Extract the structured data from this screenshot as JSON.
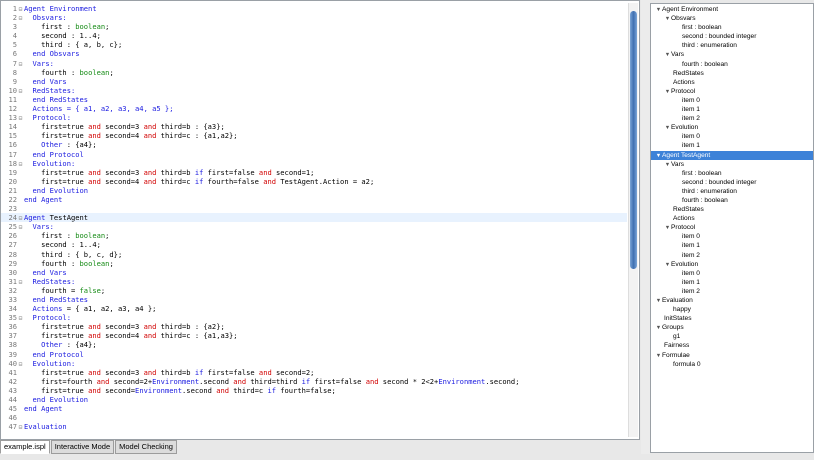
{
  "editor": {
    "current_line": 24,
    "lines": [
      {
        "n": "1",
        "fold": "⊟",
        "tokens": [
          {
            "t": "Agent Environment",
            "c": "section"
          }
        ]
      },
      {
        "n": "2",
        "fold": "⊟",
        "tokens": [
          {
            "t": "  Obsvars:",
            "c": "section"
          }
        ]
      },
      {
        "n": "3",
        "tokens": [
          {
            "t": "    first : "
          },
          {
            "t": "boolean",
            "c": "val"
          },
          {
            "t": ";"
          }
        ]
      },
      {
        "n": "4",
        "tokens": [
          {
            "t": "    second : 1..4;"
          }
        ]
      },
      {
        "n": "5",
        "tokens": [
          {
            "t": "    third : { a, b, c};"
          }
        ]
      },
      {
        "n": "6",
        "tokens": [
          {
            "t": "  end Obsvars",
            "c": "section"
          }
        ]
      },
      {
        "n": "7",
        "fold": "⊟",
        "tokens": [
          {
            "t": "  Vars:",
            "c": "section"
          }
        ]
      },
      {
        "n": "8",
        "tokens": [
          {
            "t": "    fourth : "
          },
          {
            "t": "boolean",
            "c": "val"
          },
          {
            "t": ";"
          }
        ]
      },
      {
        "n": "9",
        "tokens": [
          {
            "t": "  end Vars",
            "c": "section"
          }
        ]
      },
      {
        "n": "10",
        "fold": "⊟",
        "tokens": [
          {
            "t": "  RedStates:",
            "c": "section"
          }
        ]
      },
      {
        "n": "11",
        "tokens": [
          {
            "t": "  end RedStates",
            "c": "section"
          }
        ]
      },
      {
        "n": "12",
        "tokens": [
          {
            "t": "  Actions = { a1, a2, a3, a4, a5 };",
            "c": "section"
          }
        ]
      },
      {
        "n": "13",
        "fold": "⊟",
        "tokens": [
          {
            "t": "  Protocol:",
            "c": "section"
          }
        ]
      },
      {
        "n": "14",
        "tokens": [
          {
            "t": "    first=true "
          },
          {
            "t": "and",
            "c": "op"
          },
          {
            "t": " second=3 "
          },
          {
            "t": "and",
            "c": "op"
          },
          {
            "t": " third=b : {a3};"
          }
        ]
      },
      {
        "n": "15",
        "tokens": [
          {
            "t": "    first=true "
          },
          {
            "t": "and",
            "c": "op"
          },
          {
            "t": " second=4 "
          },
          {
            "t": "and",
            "c": "op"
          },
          {
            "t": " third=c : {a1,a2};"
          }
        ]
      },
      {
        "n": "16",
        "tokens": [
          {
            "t": "    Other",
            "c": "section"
          },
          {
            "t": " : {a4};"
          }
        ]
      },
      {
        "n": "17",
        "tokens": [
          {
            "t": "  end Protocol",
            "c": "section"
          }
        ]
      },
      {
        "n": "18",
        "fold": "⊟",
        "tokens": [
          {
            "t": "  Evolution:",
            "c": "section"
          }
        ]
      },
      {
        "n": "19",
        "tokens": [
          {
            "t": "    first=true "
          },
          {
            "t": "and",
            "c": "op"
          },
          {
            "t": " second=3 "
          },
          {
            "t": "and",
            "c": "op"
          },
          {
            "t": " third=b "
          },
          {
            "t": "if",
            "c": "section"
          },
          {
            "t": " first=false "
          },
          {
            "t": "and",
            "c": "op"
          },
          {
            "t": " second=1;"
          }
        ]
      },
      {
        "n": "20",
        "tokens": [
          {
            "t": "    first=true "
          },
          {
            "t": "and",
            "c": "op"
          },
          {
            "t": " second=4 "
          },
          {
            "t": "and",
            "c": "op"
          },
          {
            "t": " third=c "
          },
          {
            "t": "if",
            "c": "section"
          },
          {
            "t": " fourth=false "
          },
          {
            "t": "and",
            "c": "op"
          },
          {
            "t": " TestAgent.Action = a2;"
          }
        ]
      },
      {
        "n": "21",
        "tokens": [
          {
            "t": "  end Evolution",
            "c": "section"
          }
        ]
      },
      {
        "n": "22",
        "tokens": [
          {
            "t": "end Agent",
            "c": "section"
          }
        ]
      },
      {
        "n": "23",
        "tokens": []
      },
      {
        "n": "24",
        "fold": "⊟",
        "tokens": [
          {
            "t": "Agent",
            "c": "section"
          },
          {
            "t": " TestAgent"
          }
        ]
      },
      {
        "n": "25",
        "fold": "⊟",
        "tokens": [
          {
            "t": "  Vars:",
            "c": "section"
          }
        ]
      },
      {
        "n": "26",
        "tokens": [
          {
            "t": "    first : "
          },
          {
            "t": "boolean",
            "c": "val"
          },
          {
            "t": ";"
          }
        ]
      },
      {
        "n": "27",
        "tokens": [
          {
            "t": "    second : 1..4;"
          }
        ]
      },
      {
        "n": "28",
        "tokens": [
          {
            "t": "    third : { b, c, d};"
          }
        ]
      },
      {
        "n": "29",
        "tokens": [
          {
            "t": "    fourth : "
          },
          {
            "t": "boolean",
            "c": "val"
          },
          {
            "t": ";"
          }
        ]
      },
      {
        "n": "30",
        "tokens": [
          {
            "t": "  end Vars",
            "c": "section"
          }
        ]
      },
      {
        "n": "31",
        "fold": "⊟",
        "tokens": [
          {
            "t": "  RedStates:",
            "c": "section"
          }
        ]
      },
      {
        "n": "32",
        "tokens": [
          {
            "t": "    fourth = "
          },
          {
            "t": "false",
            "c": "val"
          },
          {
            "t": ";"
          }
        ]
      },
      {
        "n": "33",
        "tokens": [
          {
            "t": "  end RedStates",
            "c": "section"
          }
        ]
      },
      {
        "n": "34",
        "tokens": [
          {
            "t": "  Actions",
            "c": "section"
          },
          {
            "t": " = { a1, a2, a3, a4 };"
          }
        ]
      },
      {
        "n": "35",
        "fold": "⊟",
        "tokens": [
          {
            "t": "  Protocol:",
            "c": "section"
          }
        ]
      },
      {
        "n": "36",
        "tokens": [
          {
            "t": "    first=true "
          },
          {
            "t": "and",
            "c": "op"
          },
          {
            "t": " second=3 "
          },
          {
            "t": "and",
            "c": "op"
          },
          {
            "t": " third=b : {a2};"
          }
        ]
      },
      {
        "n": "37",
        "tokens": [
          {
            "t": "    first=true "
          },
          {
            "t": "and",
            "c": "op"
          },
          {
            "t": " second=4 "
          },
          {
            "t": "and",
            "c": "op"
          },
          {
            "t": " third=c : {a1,a3};"
          }
        ]
      },
      {
        "n": "38",
        "tokens": [
          {
            "t": "    Other",
            "c": "section"
          },
          {
            "t": " : {a4};"
          }
        ]
      },
      {
        "n": "39",
        "tokens": [
          {
            "t": "  end Protocol",
            "c": "section"
          }
        ]
      },
      {
        "n": "40",
        "fold": "⊟",
        "tokens": [
          {
            "t": "  Evolution:",
            "c": "section"
          }
        ]
      },
      {
        "n": "41",
        "tokens": [
          {
            "t": "    first=true "
          },
          {
            "t": "and",
            "c": "op"
          },
          {
            "t": " second=3 "
          },
          {
            "t": "and",
            "c": "op"
          },
          {
            "t": " third=b "
          },
          {
            "t": "if",
            "c": "section"
          },
          {
            "t": " first=false "
          },
          {
            "t": "and",
            "c": "op"
          },
          {
            "t": " second=2;"
          }
        ]
      },
      {
        "n": "42",
        "tokens": [
          {
            "t": "    first=fourth "
          },
          {
            "t": "and",
            "c": "op"
          },
          {
            "t": " second=2+"
          },
          {
            "t": "Environment",
            "c": "section"
          },
          {
            "t": ".second "
          },
          {
            "t": "and",
            "c": "op"
          },
          {
            "t": " third=third "
          },
          {
            "t": "if",
            "c": "section"
          },
          {
            "t": " first=false "
          },
          {
            "t": "and",
            "c": "op"
          },
          {
            "t": " second * 2<2+"
          },
          {
            "t": "Environment",
            "c": "section"
          },
          {
            "t": ".second;"
          }
        ]
      },
      {
        "n": "43",
        "tokens": [
          {
            "t": "    first=true "
          },
          {
            "t": "and",
            "c": "op"
          },
          {
            "t": " second="
          },
          {
            "t": "Environment",
            "c": "section"
          },
          {
            "t": ".second "
          },
          {
            "t": "and",
            "c": "op"
          },
          {
            "t": " third=c "
          },
          {
            "t": "if",
            "c": "section"
          },
          {
            "t": " fourth=false;"
          }
        ]
      },
      {
        "n": "44",
        "tokens": [
          {
            "t": "  end Evolution",
            "c": "section"
          }
        ]
      },
      {
        "n": "45",
        "tokens": [
          {
            "t": "end Agent",
            "c": "section"
          }
        ]
      },
      {
        "n": "46",
        "tokens": []
      },
      {
        "n": "47",
        "fold": "⊟",
        "tokens": [
          {
            "t": "Evaluation",
            "c": "section"
          }
        ]
      }
    ]
  },
  "tabs": [
    {
      "label": "example.ispl",
      "active": true
    },
    {
      "label": "Interactive Mode",
      "active": false
    },
    {
      "label": "Model Checking",
      "active": false
    }
  ],
  "outline": [
    {
      "label": "Agent Environment",
      "level": 0,
      "expand": true
    },
    {
      "label": "Obsvars",
      "level": 1,
      "expand": true
    },
    {
      "label": "first : boolean",
      "level": 3
    },
    {
      "label": "second : bounded integer",
      "level": 3
    },
    {
      "label": "third : enumeration",
      "level": 3
    },
    {
      "label": "Vars",
      "level": 1,
      "expand": true
    },
    {
      "label": "fourth : boolean",
      "level": 3
    },
    {
      "label": "RedStates",
      "level": 2
    },
    {
      "label": "Actions",
      "level": 2
    },
    {
      "label": "Protocol",
      "level": 1,
      "expand": true
    },
    {
      "label": "item 0",
      "level": 3
    },
    {
      "label": "item 1",
      "level": 3
    },
    {
      "label": "item 2",
      "level": 3
    },
    {
      "label": "Evolution",
      "level": 1,
      "expand": true
    },
    {
      "label": "item 0",
      "level": 3
    },
    {
      "label": "item 1",
      "level": 3
    },
    {
      "label": "Agent TestAgent",
      "level": 0,
      "expand": true,
      "selected": true
    },
    {
      "label": "Vars",
      "level": 1,
      "expand": true
    },
    {
      "label": "first : boolean",
      "level": 3
    },
    {
      "label": "second : bounded integer",
      "level": 3
    },
    {
      "label": "third : enumeration",
      "level": 3
    },
    {
      "label": "fourth : boolean",
      "level": 3
    },
    {
      "label": "RedStates",
      "level": 2
    },
    {
      "label": "Actions",
      "level": 2
    },
    {
      "label": "Protocol",
      "level": 1,
      "expand": true
    },
    {
      "label": "item 0",
      "level": 3
    },
    {
      "label": "item 1",
      "level": 3
    },
    {
      "label": "item 2",
      "level": 3
    },
    {
      "label": "Evolution",
      "level": 1,
      "expand": true
    },
    {
      "label": "item 0",
      "level": 3
    },
    {
      "label": "item 1",
      "level": 3
    },
    {
      "label": "item 2",
      "level": 3
    },
    {
      "label": "Evaluation",
      "level": 0,
      "expand": true
    },
    {
      "label": "happy",
      "level": 2
    },
    {
      "label": "InitStates",
      "level": 1
    },
    {
      "label": "Groups",
      "level": 0,
      "expand": true
    },
    {
      "label": "g1",
      "level": 2
    },
    {
      "label": "Fairness",
      "level": 1
    },
    {
      "label": "Formulae",
      "level": 0,
      "expand": true
    },
    {
      "label": "formula 0",
      "level": 2
    }
  ]
}
